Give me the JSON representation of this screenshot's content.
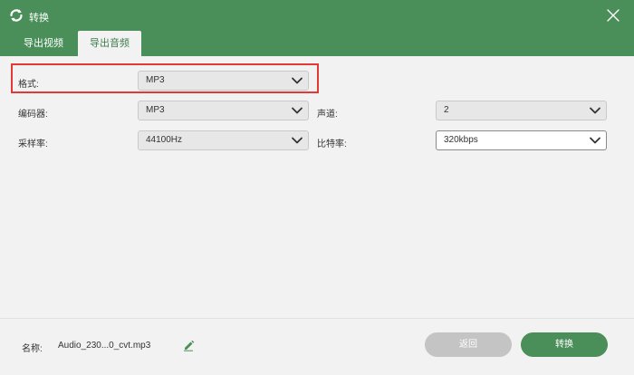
{
  "window": {
    "title": "转换",
    "icon": "refresh-icon",
    "close_icon": "close-icon"
  },
  "tabs": [
    {
      "label": "导出视频",
      "active": false
    },
    {
      "label": "导出音频",
      "active": true
    }
  ],
  "settings": {
    "format": {
      "label": "格式:",
      "value": "MP3"
    },
    "encoder": {
      "label": "编码器:",
      "value": "MP3"
    },
    "channel": {
      "label": "声道:",
      "value": "2"
    },
    "sample_rate": {
      "label": "采样率:",
      "value": "44100Hz"
    },
    "bitrate": {
      "label": "比特率:",
      "value": "320kbps"
    }
  },
  "footer": {
    "name_label": "名称:",
    "file_name": "Audio_230...0_cvt.mp3",
    "back_label": "返回",
    "convert_label": "转换"
  },
  "colors": {
    "accent": "#4a8e59",
    "highlight": "#e53935",
    "back_button": "#c4c4c4"
  }
}
